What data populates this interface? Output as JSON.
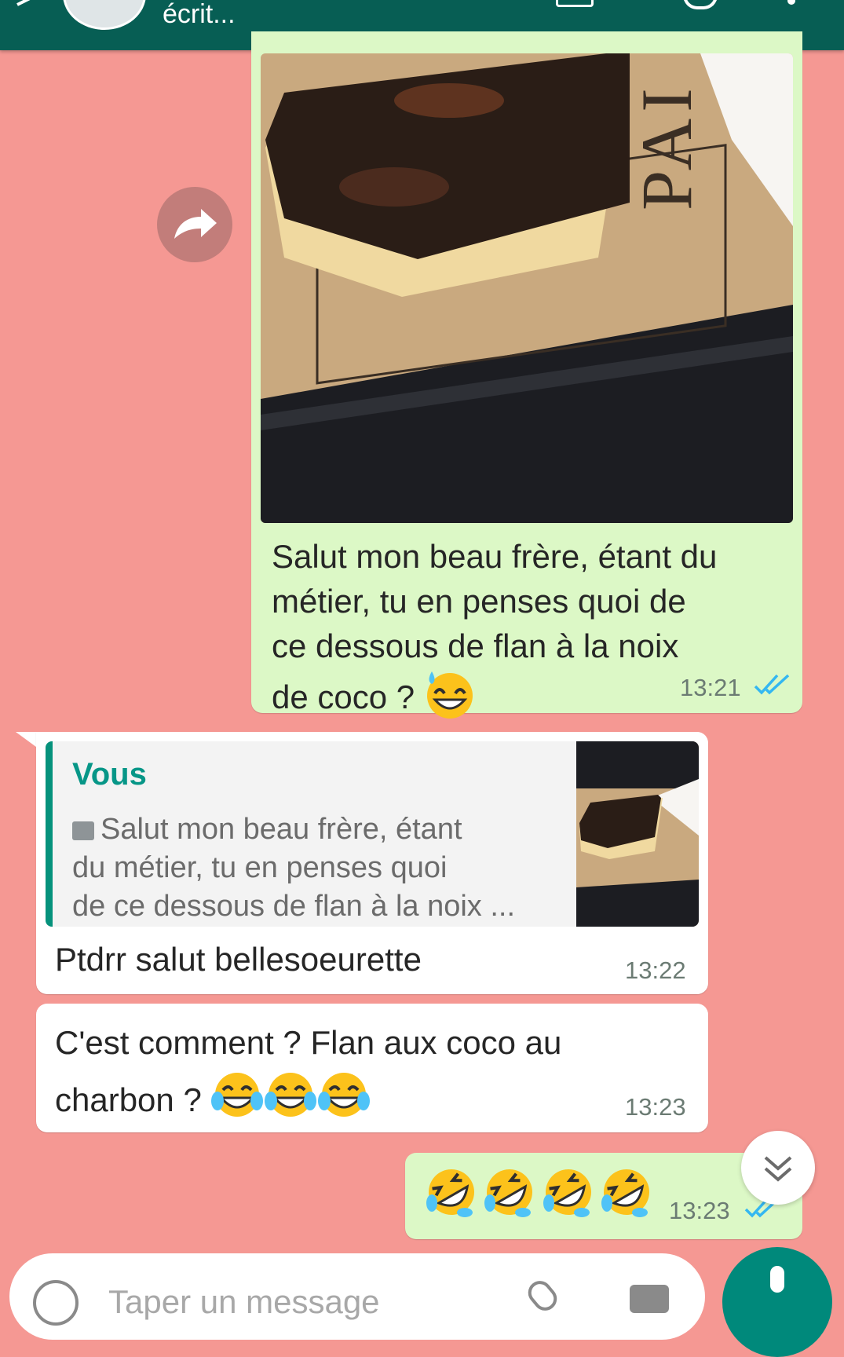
{
  "header": {
    "status": "écrit..."
  },
  "messages": {
    "sent_image": {
      "caption_lines": [
        "Salut mon beau frère, étant du",
        "métier, tu en penses quoi de",
        "ce dessous de flan à la noix",
        "de coco ?"
      ],
      "caption_emoji": "grinning-face-with-sweat",
      "time": "13:21",
      "photo_watermark": "PAI"
    },
    "reply": {
      "quote_author": "Vous",
      "quote_lines": [
        "Salut mon beau frère, étant",
        "du métier, tu en penses quoi",
        "de ce dessous de flan à la noix ..."
      ],
      "text": "Ptdrr salut bellesoeurette",
      "time": "13:22"
    },
    "received2": {
      "line1": "C'est comment ? Flan aux coco au",
      "line2": "charbon ?",
      "emojis": [
        "face-with-tears-of-joy",
        "face-with-tears-of-joy",
        "face-with-tears-of-joy"
      ],
      "time": "13:23"
    },
    "sent3": {
      "emojis": [
        "rolling-on-the-floor-laughing",
        "rolling-on-the-floor-laughing",
        "rolling-on-the-floor-laughing",
        "rolling-on-the-floor-laughing"
      ],
      "time": "13:23"
    }
  },
  "input": {
    "placeholder": "Taper un message"
  },
  "colors": {
    "chat_background": "#f59893",
    "header": "#075e54",
    "sent_bubble": "#dcf8c6",
    "received_bubble": "#ffffff",
    "read_ticks": "#34b7f1",
    "accent": "#069687"
  }
}
